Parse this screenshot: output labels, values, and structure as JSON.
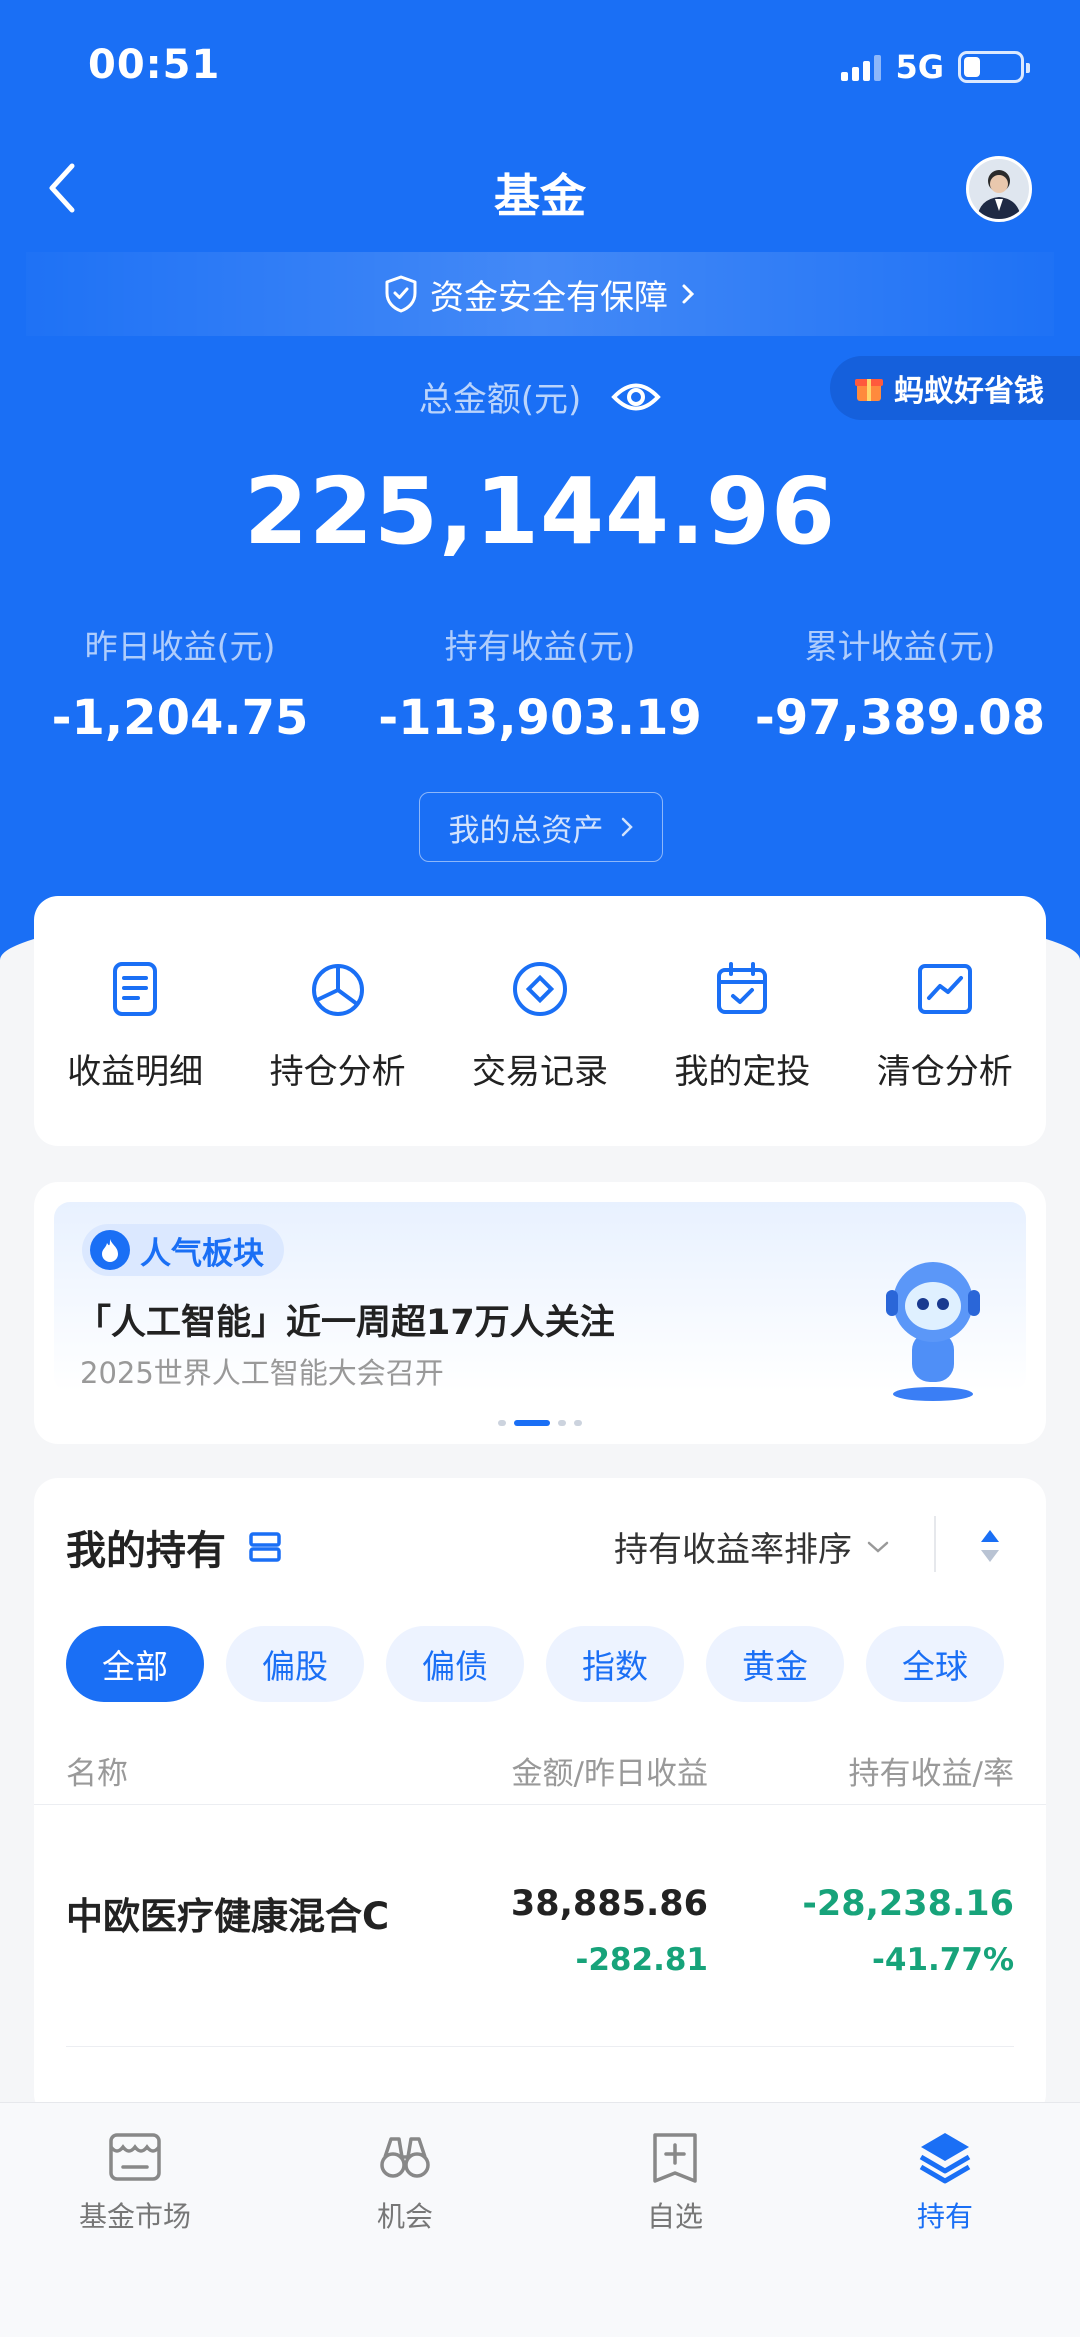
{
  "status": {
    "time": "00:51",
    "network": "5G"
  },
  "nav": {
    "title": "基金"
  },
  "safety": {
    "text": "资金安全有保障"
  },
  "promo": {
    "text": "蚂蚁好省钱"
  },
  "total": {
    "label": "总金额(元)",
    "amount": "225,144.96"
  },
  "stats": [
    {
      "label": "昨日收益(元)",
      "value": "-1,204.75"
    },
    {
      "label": "持有收益(元)",
      "value": "-113,903.19"
    },
    {
      "label": "累计收益(元)",
      "value": "-97,389.08"
    }
  ],
  "assets_button": "我的总资产",
  "quick_actions": [
    {
      "label": "收益明细",
      "icon": "document-icon"
    },
    {
      "label": "持仓分析",
      "icon": "pie-chart-icon"
    },
    {
      "label": "交易记录",
      "icon": "diamond-circle-icon"
    },
    {
      "label": "我的定投",
      "icon": "calendar-check-icon"
    },
    {
      "label": "清仓分析",
      "icon": "trend-chart-icon"
    }
  ],
  "banner": {
    "tag": "人气板块",
    "title": "「人工智能」近一周超17万人关注",
    "subtitle": "2025世界人工智能大会召开"
  },
  "holdings": {
    "title": "我的持有",
    "sort_label": "持有收益率排序",
    "chips": [
      "全部",
      "偏股",
      "偏债",
      "指数",
      "黄金",
      "全球"
    ],
    "columns": {
      "name": "名称",
      "amount": "金额/昨日收益",
      "profit": "持有收益/率"
    },
    "rows": [
      {
        "name": "中欧医疗健康混合C",
        "amount": "38,885.86",
        "yesterday": "-282.81",
        "profit": "-28,238.16",
        "rate": "-41.77%"
      }
    ]
  },
  "tabs": [
    {
      "label": "基金市场",
      "icon": "market-icon"
    },
    {
      "label": "机会",
      "icon": "binoculars-icon"
    },
    {
      "label": "自选",
      "icon": "add-bookmark-icon"
    },
    {
      "label": "持有",
      "icon": "layers-icon"
    }
  ],
  "colors": {
    "brand": "#1a6ff5",
    "loss": "#17a37a",
    "text": "#222222"
  }
}
